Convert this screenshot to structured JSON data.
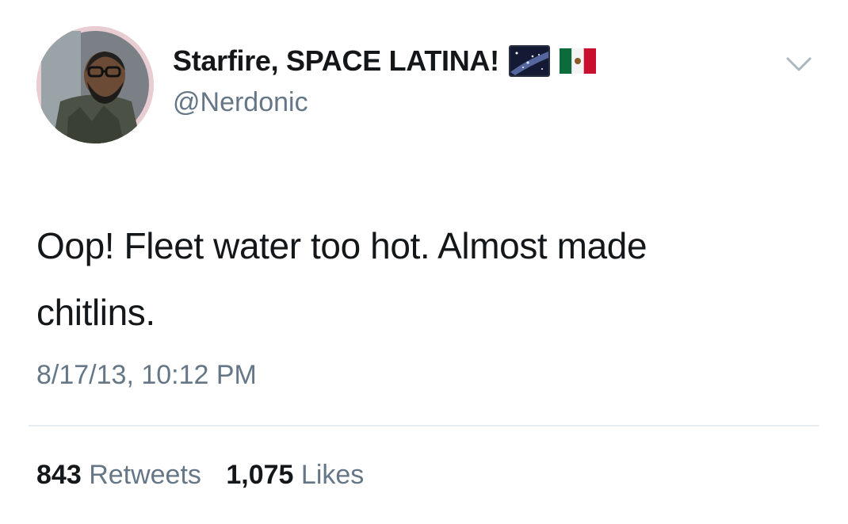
{
  "tweet": {
    "author": {
      "name": "Starfire, SPACE LATINA!",
      "handle": "@Nerdonic",
      "avatar_icon": "profile-photo",
      "name_emojis": [
        "milky-way-emoji",
        "mexico-flag-emoji"
      ]
    },
    "menu_icon": "chevron-down-icon",
    "text_line_1": "Oop! Fleet water too hot. Almost made",
    "text_line_2": "chitlins.",
    "timestamp": "8/17/13, 10:12 PM",
    "stats": {
      "retweets_count": "843",
      "retweets_label": "Retweets",
      "likes_count": "1,075",
      "likes_label": "Likes"
    },
    "colors": {
      "text": "#14171a",
      "secondary": "#657786",
      "divider": "#e6ecf0"
    }
  }
}
